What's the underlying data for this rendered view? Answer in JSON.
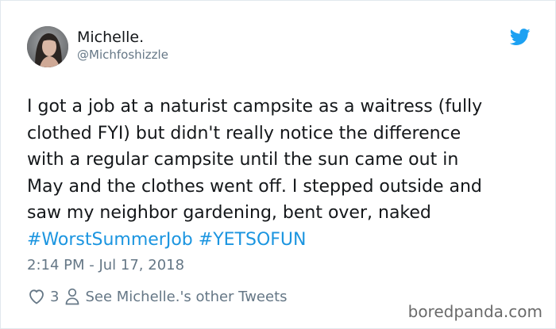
{
  "author": {
    "display_name": "Michelle.",
    "handle": "@Michfoshizzle"
  },
  "icons": {
    "platform": "twitter-bird-icon",
    "like": "heart-icon",
    "profile": "person-icon"
  },
  "colors": {
    "hashtag": "#1b95e0",
    "bird": "#1da1f2",
    "secondary_text": "#657786"
  },
  "tweet": {
    "lines": [
      "I got a job at a naturist campsite as a waitress (fully",
      "clothed FYI) but didn't really notice the difference",
      "with a regular campsite until the sun came out in",
      "May and the clothes went off. I stepped outside and",
      "saw my neighbor gardening, bent over, naked"
    ],
    "hashtags": [
      "#WorstSummerJob",
      "#YETSOFUN"
    ],
    "timestamp": "2:14 PM - Jul 17, 2018"
  },
  "actions": {
    "like_count": "3",
    "see_other_tweets": "See Michelle.'s other Tweets"
  },
  "watermark": "boredpanda.com"
}
